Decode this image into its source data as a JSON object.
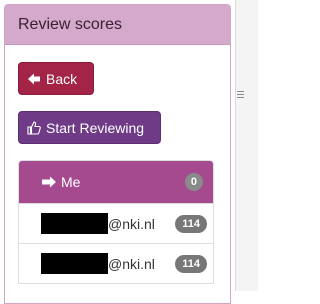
{
  "panel": {
    "title": "Review scores"
  },
  "buttons": {
    "back_label": "Back",
    "start_label": "Start Reviewing"
  },
  "list": {
    "me": {
      "label": "Me",
      "count": "0"
    },
    "items": [
      {
        "domain": "@nki.nl",
        "count": "114"
      },
      {
        "domain": "@nki.nl",
        "count": "114"
      }
    ]
  },
  "colors": {
    "heading_bg": "#d4a9cb",
    "back_button": "#a32447",
    "start_button": "#6f3b86",
    "active_item": "#a54a8e",
    "badge": "#777777"
  },
  "icons": {
    "back": "arrow-left-icon",
    "start": "thumbs-up-icon",
    "me": "arrow-right-icon"
  }
}
